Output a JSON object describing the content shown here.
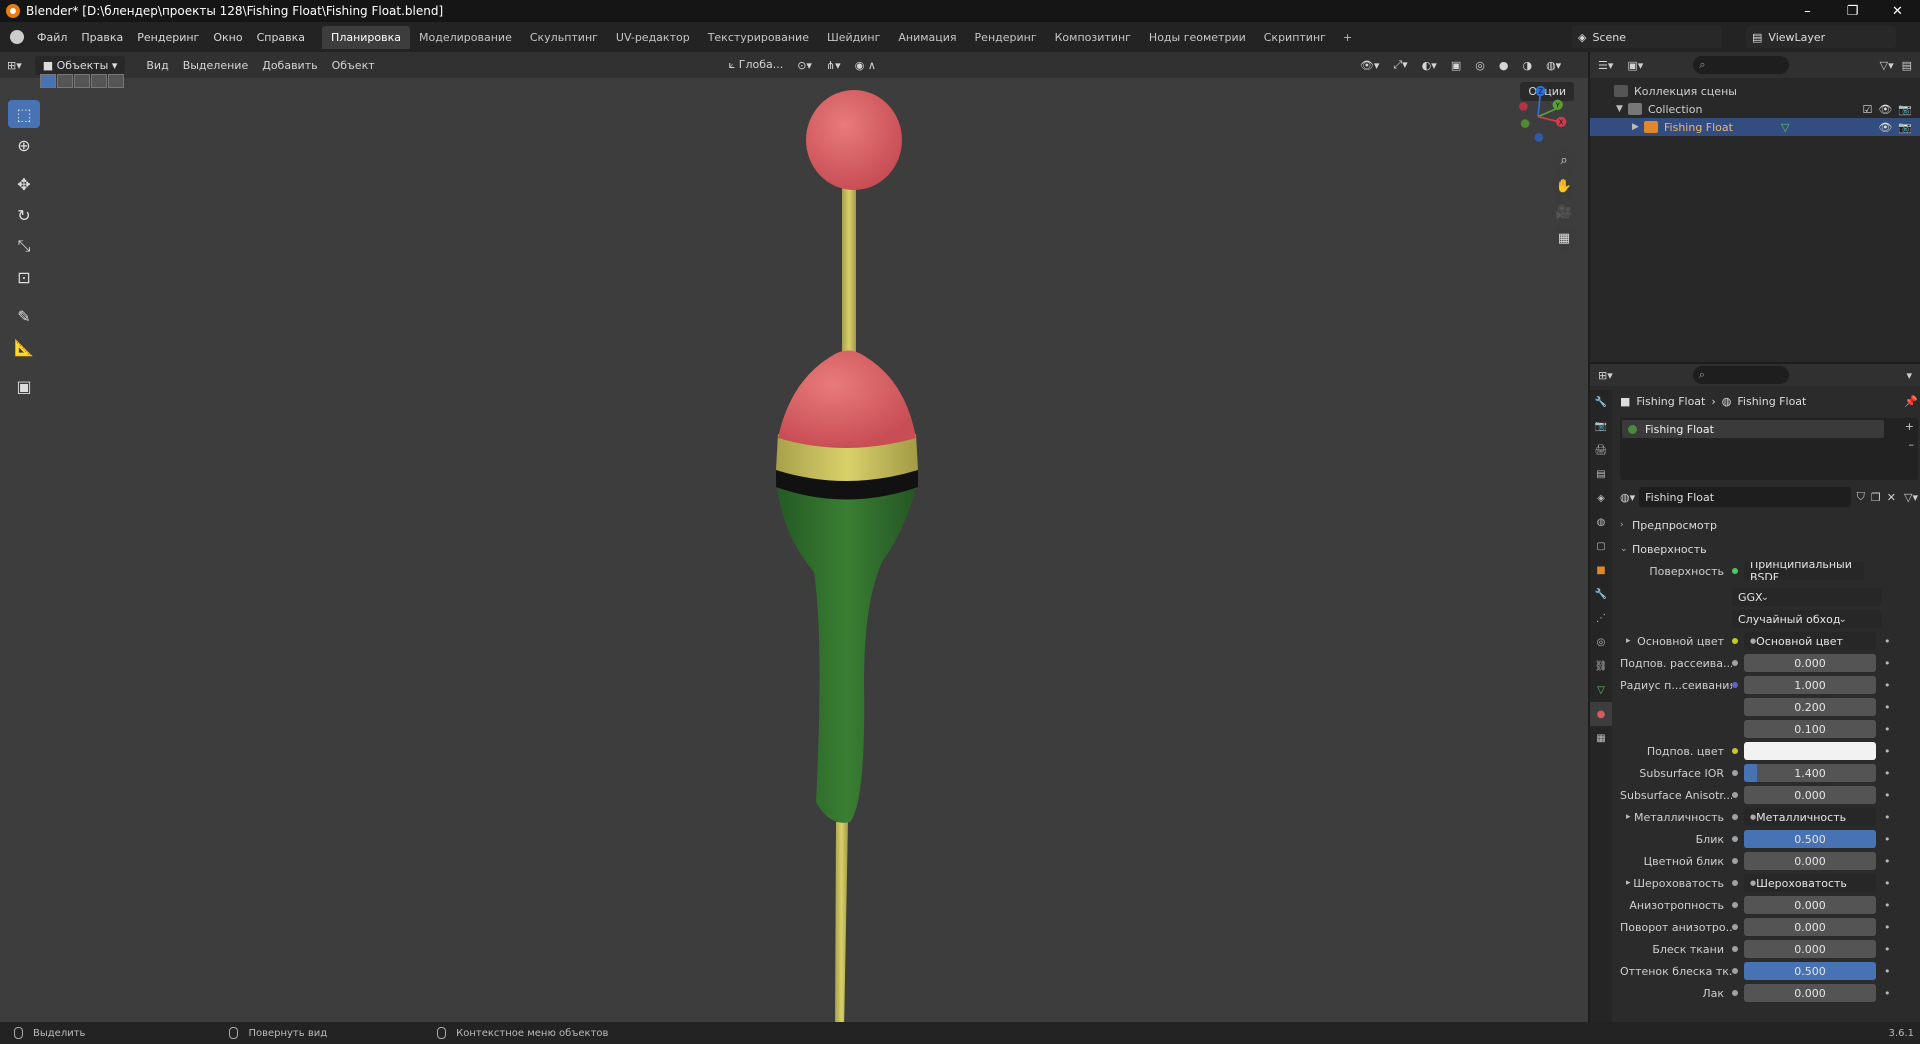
{
  "window": {
    "title": "Blender* [D:\\блендер\\проекты 128\\Fishing Float\\Fishing Float.blend]",
    "controls": [
      "–",
      "❐",
      "✕"
    ]
  },
  "menu": [
    "Файл",
    "Правка",
    "Рендеринг",
    "Окно",
    "Справка"
  ],
  "workspaces": [
    "Планировка",
    "Моделирование",
    "Скульптинг",
    "UV-редактор",
    "Текстурирование",
    "Шейдинг",
    "Анимация",
    "Рендеринг",
    "Композитинг",
    "Ноды геометрии",
    "Скриптинг"
  ],
  "workspace_add": "+",
  "scene": {
    "name": "Scene",
    "view_layer": "ViewLayer"
  },
  "viewport": {
    "mode": "Объекты",
    "menus": [
      "Вид",
      "Выделение",
      "Добавить",
      "Объект"
    ],
    "transform_orientation": "Глоба...",
    "options": "Опции",
    "gizmo_labels": {
      "z": "Z",
      "y": "Y",
      "x": "X"
    }
  },
  "outliner": {
    "scene_collection": "Коллекция сцены",
    "collection": "Collection",
    "object": "Fishing Float"
  },
  "properties": {
    "breadcrumb": [
      "Fishing Float",
      "Fishing Float"
    ],
    "slot": "Fishing Float",
    "material": "Fishing Float",
    "section_preview": "Предпросмотр",
    "section_surface": "Поверхность",
    "surface_label": "Поверхность",
    "surface_value": "Принципиальный BSDF",
    "distribution": "GGX",
    "subsurface_method": "Случайный обход",
    "rows": [
      {
        "label": "Основной цвет",
        "value": "Основной цвет",
        "kind": "link",
        "arrow": true,
        "sock": "#c7c729"
      },
      {
        "label": "Подпов. рассеива...",
        "value": "0.000",
        "kind": "num",
        "fill": 0,
        "sock": "#a1a1a1"
      },
      {
        "label": "Радиус п...сеивания",
        "value": "1.000",
        "kind": "num",
        "fill": 0,
        "sock": "#6363c7"
      },
      {
        "label": "",
        "value": "0.200",
        "kind": "num",
        "fill": 0
      },
      {
        "label": "",
        "value": "0.100",
        "kind": "num",
        "fill": 0
      },
      {
        "label": "Подпов. цвет",
        "value": "",
        "kind": "color",
        "sock": "#c7c729"
      },
      {
        "label": "Subsurface IOR",
        "value": "1.400",
        "kind": "num",
        "fill": 0.1,
        "sock": "#a1a1a1"
      },
      {
        "label": "Subsurface Anisotr...",
        "value": "0.000",
        "kind": "num",
        "fill": 0,
        "sock": "#a1a1a1"
      },
      {
        "label": "Металличность",
        "value": "Металличность",
        "kind": "link",
        "arrow": true,
        "sock": "#a1a1a1"
      },
      {
        "label": "Блик",
        "value": "0.500",
        "kind": "num",
        "fill": 1,
        "sock": "#a1a1a1"
      },
      {
        "label": "Цветной блик",
        "value": "0.000",
        "kind": "num",
        "fill": 0,
        "sock": "#a1a1a1"
      },
      {
        "label": "Шероховатость",
        "value": "Шероховатость",
        "kind": "link",
        "arrow": true,
        "sock": "#a1a1a1"
      },
      {
        "label": "Анизотропность",
        "value": "0.000",
        "kind": "num",
        "fill": 0,
        "sock": "#a1a1a1"
      },
      {
        "label": "Поворот анизотро...",
        "value": "0.000",
        "kind": "num",
        "fill": 0,
        "sock": "#a1a1a1"
      },
      {
        "label": "Блеск ткани",
        "value": "0.000",
        "kind": "num",
        "fill": 0,
        "sock": "#a1a1a1"
      },
      {
        "label": "Оттенок блеска тк...",
        "value": "0.500",
        "kind": "num",
        "fill": 1,
        "sock": "#a1a1a1"
      },
      {
        "label": "Лак",
        "value": "0.000",
        "kind": "num",
        "fill": 0,
        "sock": "#a1a1a1"
      }
    ]
  },
  "statusbar": {
    "select": "Выделить",
    "rotate": "Повернуть вид",
    "context": "Контекстное меню объектов",
    "version": "3.6.1"
  },
  "colors": {
    "accent": "#4772b3",
    "float_red": "#d35d5d",
    "float_green": "#2d6b2d",
    "float_yellow": "#c9c45a"
  }
}
